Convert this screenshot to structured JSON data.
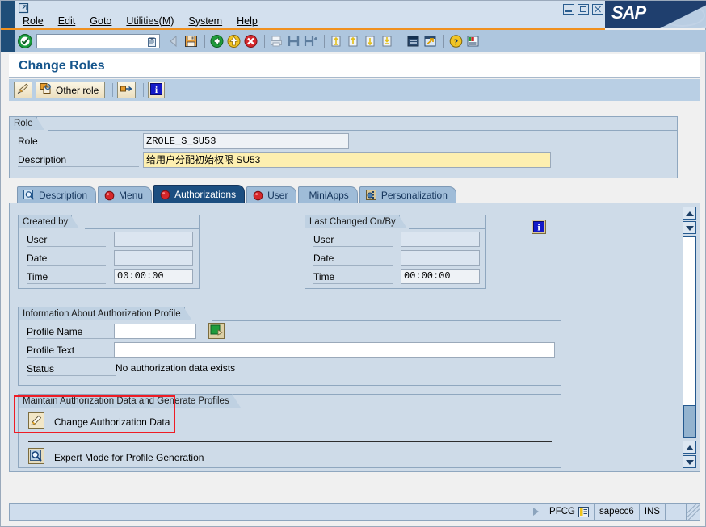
{
  "window": {
    "system_menu_icon": "sap-system-menu-icon",
    "minimize_label": "Minimize",
    "maximize_label": "Maximize",
    "close_label": "Close",
    "logo_text": "SAP"
  },
  "menubar": {
    "items": [
      {
        "label": "Role",
        "accel": "R"
      },
      {
        "label": "Edit",
        "accel": "E"
      },
      {
        "label": "Goto",
        "accel": "G"
      },
      {
        "label": "Utilities(M)",
        "accel": "M"
      },
      {
        "label": "System",
        "accel": "y"
      },
      {
        "label": "Help",
        "accel": "H"
      }
    ]
  },
  "toolbar": {
    "enter_icon": "green-check-enter-icon",
    "command_field_value": "",
    "command_field_placeholder": "",
    "command_dropdown_icon": "command-field-dropdown-icon",
    "buttons": [
      {
        "name": "back-arrow-icon",
        "title": "Back"
      },
      {
        "name": "save-icon",
        "title": "Save"
      },
      {
        "name": "green-back-icon",
        "title": "Back"
      },
      {
        "name": "yellow-exit-icon",
        "title": "Exit"
      },
      {
        "name": "red-cancel-icon",
        "title": "Cancel"
      },
      {
        "name": "print-icon",
        "title": "Print"
      },
      {
        "name": "find-icon",
        "title": "Find"
      },
      {
        "name": "find-next-icon",
        "title": "Find Next"
      },
      {
        "name": "first-page-icon",
        "title": "First Page"
      },
      {
        "name": "previous-page-icon",
        "title": "Previous Page"
      },
      {
        "name": "next-page-icon",
        "title": "Next Page"
      },
      {
        "name": "last-page-icon",
        "title": "Last Page"
      },
      {
        "name": "create-session-icon",
        "title": "Create New Session"
      },
      {
        "name": "create-shortcut-icon",
        "title": "Create Shortcut"
      },
      {
        "name": "help-icon",
        "title": "Help"
      },
      {
        "name": "layout-menu-icon",
        "title": "Customize Local Layout"
      }
    ]
  },
  "page": {
    "title": "Change Roles"
  },
  "apptoolbar": {
    "buttons": [
      {
        "name": "change-display-button",
        "label": "",
        "icon": "pencil-ruler-icon"
      },
      {
        "name": "other-role-button",
        "label": "Other role",
        "icon": "other-role-icon"
      },
      {
        "name": "transaction-inheritance-button",
        "label": "",
        "icon": "inheritance-icon"
      },
      {
        "name": "info-button",
        "label": "",
        "icon": "information-icon"
      }
    ]
  },
  "role_group": {
    "title": "Role",
    "fields": [
      {
        "label": "Role",
        "value": "ZROLE_S_SU53",
        "style": "readonly"
      },
      {
        "label": "Description",
        "value": "给用户分配初始权限 SU53",
        "style": "editable"
      }
    ]
  },
  "tabs": [
    {
      "label": "Description",
      "icon": "description-magnifier-icon",
      "active": false
    },
    {
      "label": "Menu",
      "icon": "red-ball-icon",
      "active": false
    },
    {
      "label": "Authorizations",
      "icon": "red-ball-icon",
      "active": true
    },
    {
      "label": "User",
      "icon": "red-ball-icon",
      "active": false
    },
    {
      "label": "MiniApps",
      "icon": "",
      "active": false
    },
    {
      "label": "Personalization",
      "icon": "personalization-icon",
      "active": false
    }
  ],
  "created_by": {
    "title": "Created by",
    "rows": [
      {
        "label": "User",
        "value": ""
      },
      {
        "label": "Date",
        "value": ""
      },
      {
        "label": "Time",
        "value": "00:00:00"
      }
    ]
  },
  "last_changed": {
    "title": "Last Changed On/By",
    "rows": [
      {
        "label": "User",
        "value": ""
      },
      {
        "label": "Date",
        "value": ""
      },
      {
        "label": "Time",
        "value": "00:00:00"
      }
    ]
  },
  "info_button_icon": "information-icon",
  "profile_info": {
    "title": "Information About Authorization Profile",
    "profile_name_label": "Profile Name",
    "profile_name_value": "",
    "profile_name_picker_icon": "profile-select-icon",
    "profile_text_label": "Profile Text",
    "profile_text_value": "",
    "status_label": "Status",
    "status_value": "No authorization data exists"
  },
  "maintain": {
    "title": "Maintain Authorization Data and Generate Profiles",
    "change_auth_label": "Change Authorization Data",
    "change_auth_icon": "pencil-icon",
    "expert_mode_label": "Expert Mode for Profile Generation",
    "expert_mode_icon": "expert-mode-magnifier-icon"
  },
  "annotation": {
    "highlight_color": "#ee1c25"
  },
  "statusbar": {
    "message": "",
    "expand_icon": "status-expand-icon",
    "transaction": "PFCG",
    "transaction_icon": "transaction-menu-icon",
    "system": "sapecc6",
    "insert_mode": "INS",
    "extra": ""
  }
}
